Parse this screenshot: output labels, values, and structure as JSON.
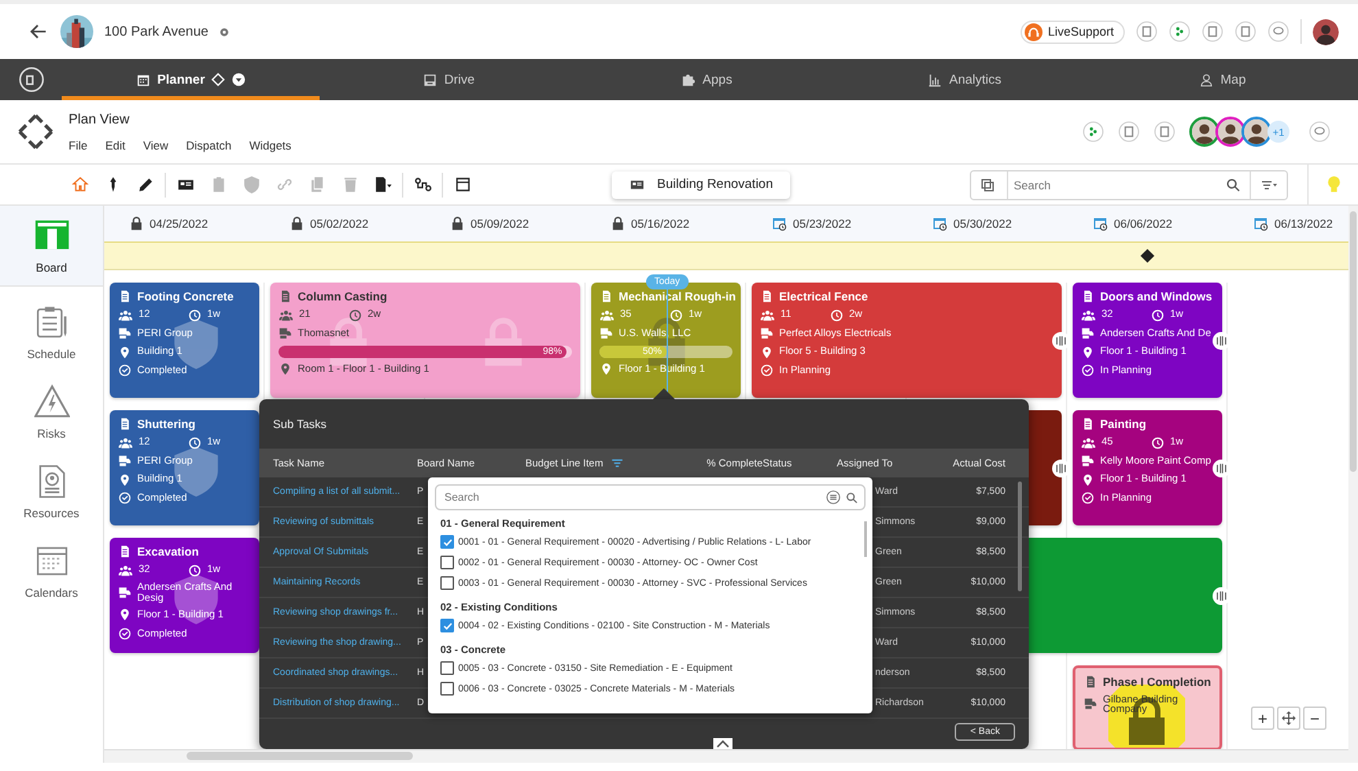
{
  "header": {
    "title": "100 Park Avenue",
    "live_support": "LiveSupport"
  },
  "nav_tabs": [
    {
      "label": "Planner",
      "selected": true
    },
    {
      "label": "Drive",
      "selected": false
    },
    {
      "label": "Apps",
      "selected": false
    },
    {
      "label": "Analytics",
      "selected": false
    },
    {
      "label": "Map",
      "selected": false
    }
  ],
  "plan": {
    "title": "Plan View",
    "menu": [
      "File",
      "Edit",
      "View",
      "Dispatch",
      "Widgets"
    ],
    "collaborators": [
      {
        "color": "#1e9e3e"
      },
      {
        "color": "#e020c0"
      },
      {
        "color": "#2a8fd8"
      }
    ],
    "more_collaborators": "+1"
  },
  "toolbar": {
    "tools": [
      {
        "selected": true,
        "disabled": false
      },
      {
        "selected": false,
        "disabled": false
      },
      {
        "selected": false,
        "disabled": false
      },
      {
        "selected": false,
        "disabled": false
      },
      {
        "selected": false,
        "disabled": true
      },
      {
        "selected": false,
        "disabled": true
      },
      {
        "selected": false,
        "disabled": true
      },
      {
        "selected": false,
        "disabled": true
      },
      {
        "selected": false,
        "disabled": true
      },
      {
        "selected": false,
        "disabled": false
      },
      {
        "selected": false,
        "disabled": false
      },
      {
        "selected": false,
        "disabled": false
      }
    ],
    "board": "Building Renovation",
    "search": {
      "placeholder": "Search"
    }
  },
  "sidebar": [
    {
      "label": "Board",
      "selected": true
    },
    {
      "label": "Schedule",
      "selected": false
    },
    {
      "label": "Risks",
      "selected": false
    },
    {
      "label": "Resources",
      "selected": false
    },
    {
      "label": "Calendars",
      "selected": false
    }
  ],
  "weeks": [
    {
      "date": "04/25/2022",
      "locked": true,
      "milestone": false
    },
    {
      "date": "05/02/2022",
      "locked": true,
      "milestone": false
    },
    {
      "date": "05/09/2022",
      "locked": true,
      "milestone": false
    },
    {
      "date": "05/16/2022",
      "locked": true,
      "milestone": false
    },
    {
      "date": "05/23/2022",
      "locked": false,
      "milestone": false
    },
    {
      "date": "05/30/2022",
      "locked": false,
      "milestone": false
    },
    {
      "date": "06/06/2022",
      "locked": false,
      "milestone": true
    },
    {
      "date": "06/13/2022",
      "locked": false,
      "milestone": false
    }
  ],
  "today": {
    "label": "Today"
  },
  "cards": [
    {
      "kind": "task",
      "title": "Footing Concrete",
      "color": "#2f5fa7",
      "crew": "12",
      "duration": "1w",
      "company": "PERI Group",
      "location": "Building 1",
      "status": "Completed",
      "locked": false,
      "shielded": true,
      "resizable": false
    },
    {
      "kind": "task",
      "title": "Column Casting",
      "color": "#f3a0cb",
      "crew": "21",
      "duration": "2w",
      "company": "Thomasnet",
      "progress": {
        "level": 0.98,
        "label": "98%"
      },
      "location": "Room 1 - Floor 1 - Building 1",
      "locked": true,
      "shielded": false,
      "resizable": false
    },
    {
      "kind": "task",
      "title": "Mechanical Rough-in",
      "color": "#9d9d1f",
      "crew": "35",
      "duration": "1w",
      "company": "U.S. Walls, LLC",
      "progress": {
        "level": 0.5,
        "label": "50%"
      },
      "location": "Floor 1 - Building 1",
      "locked": true,
      "shielded": false,
      "resizable": false
    },
    {
      "kind": "task",
      "title": "Electrical Fence",
      "color": "#d43b3b",
      "crew": "11",
      "duration": "2w",
      "company": "Perfect Alloys Electricals",
      "location": "Floor 5 - Building 3",
      "status": "In Planning",
      "locked": false,
      "shielded": false,
      "resizable": true
    },
    {
      "kind": "task",
      "title": "Doors and Windows",
      "color": "#7e05c2",
      "crew": "32",
      "duration": "1w",
      "company": "Andersen Crafts And De",
      "location": "Floor 1 - Building 1",
      "status": "In Planning",
      "locked": false,
      "shielded": false,
      "resizable": true
    },
    {
      "kind": "task",
      "title": "Shuttering",
      "color": "#2f5fa7",
      "crew": "12",
      "duration": "1w",
      "company": "PERI Group",
      "location": "Building 1",
      "status": "Completed",
      "locked": false,
      "shielded": true,
      "resizable": false
    },
    {
      "kind": "task",
      "color": "#7a1b0f",
      "locked": false,
      "shielded": false,
      "resizable": true
    },
    {
      "kind": "task",
      "title": "Painting",
      "color": "#a5037f",
      "crew": "45",
      "duration": "1w",
      "company": "Kelly Moore Paint Comp",
      "location": "Floor 1 - Building 1",
      "status": "In Planning",
      "locked": false,
      "shielded": false,
      "resizable": true
    },
    {
      "kind": "task",
      "title": "Excavation",
      "color": "#7e05c2",
      "crew": "32",
      "duration": "1w",
      "company": "Andersen Crafts And Desig",
      "location": "Floor 1 - Building 1",
      "status": "Completed",
      "locked": false,
      "shielded": true,
      "resizable": false
    },
    {
      "kind": "task",
      "color": "#0d9a34",
      "locked": false,
      "shielded": false,
      "resizable": true
    },
    {
      "kind": "milestone",
      "title": "Phase I Completion",
      "color": "#f7c6cd",
      "company": "Gilbane Building Company",
      "locked": true,
      "shielded": false,
      "resizable": false
    }
  ],
  "subtasks": {
    "title": "Sub Tasks",
    "columns": [
      "Task Name",
      "Board Name",
      "Budget Line Item",
      "% Complete",
      "Status",
      "Assigned To",
      "Actual Cost"
    ],
    "rows": [
      {
        "task": "Compiling a list of all submit...",
        "board": "P",
        "assigned": "Ward",
        "cost": "$7,500"
      },
      {
        "task": "Reviewing of submittals",
        "board": "E",
        "assigned": "Simmons",
        "cost": "$9,000"
      },
      {
        "task": "Approval Of Submitals",
        "board": "E",
        "assigned": "Green",
        "cost": "$8,500"
      },
      {
        "task": "Maintaining Records",
        "board": "E",
        "assigned": "Green",
        "cost": "$10,000"
      },
      {
        "task": "Reviewing shop drawings fr...",
        "board": "H",
        "assigned": "Simmons",
        "cost": "$8,500"
      },
      {
        "task": "Reviewing the shop drawing...",
        "board": "P",
        "assigned": "Ward",
        "cost": "$10,000"
      },
      {
        "task": "Coordinated shop drawings...",
        "board": "H",
        "assigned": "nderson",
        "cost": "$8,500"
      },
      {
        "task": "Distribution of shop drawing...",
        "board": "D",
        "assigned": "Richardson",
        "cost": "$10,000"
      }
    ],
    "back": "< Back",
    "filter": {
      "placeholder": "Search",
      "groups": [
        {
          "label": "01 - General Requirement",
          "items": [
            {
              "label": "0001 - 01 - General Requirement - 00020 - Advertising / Public Relations - L- Labor",
              "checked": true
            },
            {
              "label": "0002 - 01 - General Requirement - 00030 - Attorney- OC - Owner Cost",
              "checked": false
            },
            {
              "label": "0003 - 01 - General Requirement - 00030 - Attorney - SVC - Professional Services",
              "checked": false
            }
          ]
        },
        {
          "label": "02 - Existing Conditions",
          "items": [
            {
              "label": "0004 - 02 - Existing Conditions - 02100 - Site Construction - M - Materials",
              "checked": true
            }
          ]
        },
        {
          "label": "03 - Concrete",
          "items": [
            {
              "label": "0005 - 03 - Concrete - 03150 - Site Remediation - E - Equipment",
              "checked": false
            },
            {
              "label": "0006 - 03 - Concrete - 03025 - Concrete Materials - M - Materials",
              "checked": false
            }
          ]
        }
      ]
    }
  },
  "zoom": {
    "zoom_in": "+",
    "zoom_out": "−"
  }
}
